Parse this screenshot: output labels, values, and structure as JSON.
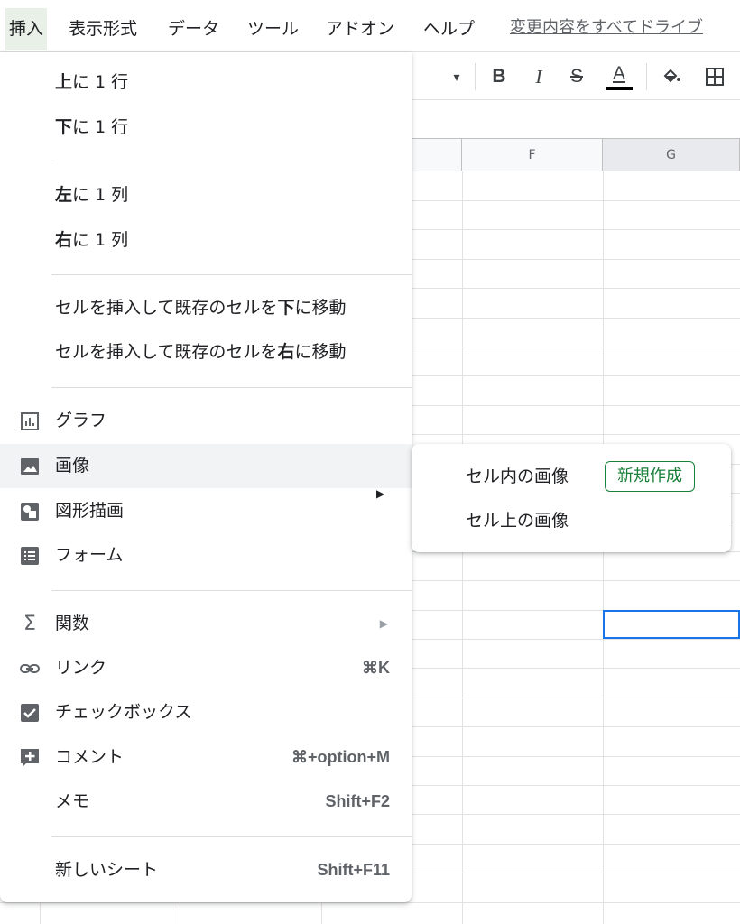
{
  "menubar": {
    "items": [
      "挿入",
      "表示形式",
      "データ",
      "ツール",
      "アドオン",
      "ヘルプ"
    ],
    "changes_link": "変更内容をすべてドライブ"
  },
  "toolbar": {
    "bold": "B",
    "italic": "I",
    "strike": "S",
    "text_color": "A"
  },
  "grid": {
    "columns": [
      "F",
      "G"
    ]
  },
  "insert_menu": {
    "rows_above": {
      "bold": "上",
      "rest": "に 1 行"
    },
    "rows_below": {
      "bold": "下",
      "rest": "に 1 行"
    },
    "col_left": {
      "bold": "左",
      "rest": "に 1 列"
    },
    "col_right": {
      "bold": "右",
      "rest": "に 1 列"
    },
    "shift_down": {
      "pre": "セルを挿入して既存のセルを",
      "bold": "下",
      "post": "に移動"
    },
    "shift_right": {
      "pre": "セルを挿入して既存のセルを",
      "bold": "右",
      "post": "に移動"
    },
    "chart": "グラフ",
    "image": "画像",
    "drawing": "図形描画",
    "form": "フォーム",
    "function": "関数",
    "link": "リンク",
    "link_shortcut": "⌘K",
    "checkbox": "チェックボックス",
    "comment": "コメント",
    "comment_shortcut": "⌘+option+M",
    "note": "メモ",
    "note_shortcut": "Shift+F2",
    "new_sheet": "新しいシート",
    "new_sheet_shortcut": "Shift+F11"
  },
  "image_submenu": {
    "in_cell": "セル内の画像",
    "new_badge": "新規作成",
    "over_cells": "セル上の画像"
  },
  "colors": {
    "accent_green": "#188038",
    "selection_blue": "#1a73e8",
    "icon_gray": "#5f6368"
  }
}
